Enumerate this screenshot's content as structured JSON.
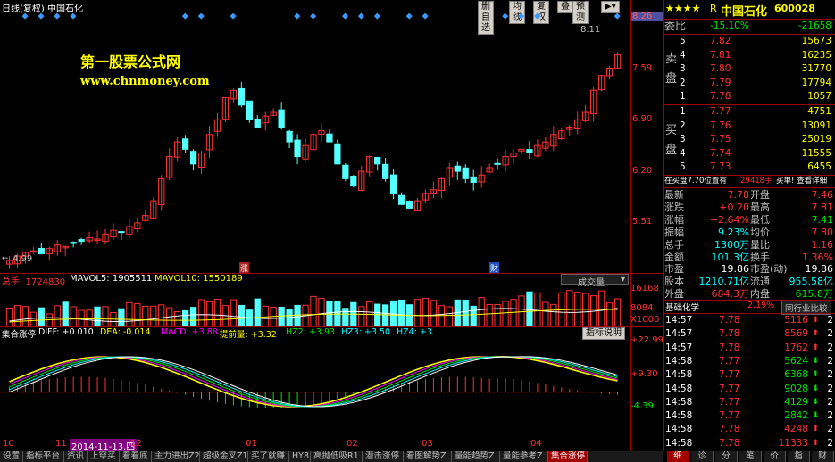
{
  "header": {
    "period": "日线(复权)",
    "stock_name": "中国石化",
    "buttons": [
      "删自选",
      "均线",
      "复权",
      "叠",
      "预测"
    ]
  },
  "watermark": {
    "line1": "第一股票公式网",
    "line2": "www.chnmoney.com"
  },
  "price_axis": {
    "max_label": "8.11",
    "min_label": "4.99",
    "ticks": [
      "8.26",
      "7.59",
      "6.90",
      "6.20",
      "5.51"
    ]
  },
  "event_markers": [
    "涨",
    "财"
  ],
  "volume_panel": {
    "title": "总手: 1724830",
    "mavol5": "MAVOL5: 1905511",
    "mavol10": "MAVOL10: 1550189",
    "dropdown": "成交量",
    "ticks": [
      "16168",
      "8084",
      "X1000"
    ]
  },
  "indicator_panel": {
    "name": "集合涨停",
    "diff": "DIFF: +0.010",
    "dea": "DEA: -0.014",
    "macd": "MACD: +3.88",
    "tiqianliang": "提前量: +3.32",
    "hz2": "HZ2: +3.93",
    "hz3": "HZ3: +3.50",
    "hz4": "HZ4: +3.",
    "button": "指标说明",
    "ticks": [
      "+22.99",
      "+9.30",
      "-4.39"
    ]
  },
  "chart_data": {
    "type": "candlestick",
    "ylim": [
      4.99,
      8.26
    ],
    "x_labels": [
      "10",
      "11",
      "2014-11-13,四",
      "12",
      "01",
      "02",
      "03",
      "04"
    ],
    "close": [
      4.99,
      5.05,
      5.1,
      5.12,
      5.08,
      5.15,
      5.2,
      5.18,
      5.22,
      5.25,
      5.3,
      5.28,
      5.35,
      5.4,
      5.38,
      5.45,
      5.5,
      5.6,
      5.8,
      6.1,
      6.4,
      6.6,
      6.5,
      6.3,
      6.45,
      6.7,
      6.9,
      7.2,
      7.3,
      7.1,
      6.9,
      6.8,
      6.95,
      7.0,
      6.8,
      6.6,
      6.4,
      6.55,
      6.7,
      6.75,
      6.6,
      6.3,
      6.1,
      6.0,
      6.2,
      6.4,
      6.3,
      6.1,
      5.9,
      5.75,
      5.7,
      5.8,
      5.9,
      5.95,
      6.1,
      6.25,
      6.2,
      6.1,
      6.05,
      6.15,
      6.25,
      6.3,
      6.4,
      6.45,
      6.5,
      6.45,
      6.55,
      6.6,
      6.7,
      6.75,
      6.8,
      6.9,
      7.0,
      7.3,
      7.5,
      7.6,
      7.78
    ],
    "volume_max": 16168,
    "macd_ylim": [
      -4.39,
      22.99
    ]
  },
  "quote": {
    "stars": "★★★★",
    "r": "R",
    "name": "中国石化",
    "code": "600028",
    "weibi_label": "委比",
    "weibi": "-15.10%",
    "weicha": "-21658",
    "sell_label": [
      "卖",
      "盘"
    ],
    "buy_label": [
      "买",
      "盘"
    ],
    "sell": [
      {
        "level": "5",
        "price": "7.82",
        "vol": "15673"
      },
      {
        "level": "4",
        "price": "7.81",
        "vol": "16235"
      },
      {
        "level": "3",
        "price": "7.80",
        "vol": "31770"
      },
      {
        "level": "2",
        "price": "7.79",
        "vol": "17794"
      },
      {
        "level": "1",
        "price": "7.78",
        "vol": "1057"
      }
    ],
    "buy": [
      {
        "level": "1",
        "price": "7.77",
        "vol": "4751"
      },
      {
        "level": "2",
        "price": "7.76",
        "vol": "13091"
      },
      {
        "level": "3",
        "price": "7.75",
        "vol": "25019"
      },
      {
        "level": "4",
        "price": "7.74",
        "vol": "11555"
      },
      {
        "level": "5",
        "price": "7.73",
        "vol": "6455"
      }
    ],
    "notice": "在买盘7.70位置有",
    "notice_vol": "29418手",
    "notice_action": "买单! 查看详细",
    "stats": [
      {
        "l1": "最新",
        "v1": "7.78",
        "l2": "开盘",
        "v2": "7.46"
      },
      {
        "l1": "涨跌",
        "v1": "+0.20",
        "l2": "最高",
        "v2": "7.81"
      },
      {
        "l1": "涨幅",
        "v1": "+2.64%",
        "l2": "最低",
        "v2": "7.41"
      },
      {
        "l1": "振幅",
        "v1": "9.23%",
        "l2": "均价",
        "v2": "7.80"
      },
      {
        "l1": "总手",
        "v1": "1300万",
        "l2": "量比",
        "v2": "1.16"
      },
      {
        "l1": "金额",
        "v1": "101.3亿",
        "l2": "换手",
        "v2": "1.36%"
      },
      {
        "l1": "市盈",
        "v1": "19.86",
        "l2": "市盈(动)",
        "v2": "19.86"
      },
      {
        "l1": "股本",
        "v1": "1210.71亿",
        "l2": "流通",
        "v2": "955.58亿"
      },
      {
        "l1": "外盘",
        "v1": "684.3万",
        "l2": "内盘",
        "v2": "615.8万"
      }
    ],
    "sector": "基础化学",
    "sector_change": "2.19%",
    "sector_button": "同行业比较",
    "ticks": [
      {
        "time": "14:57",
        "price": "7.78",
        "vol": "5116",
        "dir": "up",
        "n": "2"
      },
      {
        "time": "14:57",
        "price": "7.78",
        "vol": "8569",
        "dir": "up",
        "n": "2"
      },
      {
        "time": "14:57",
        "price": "7.78",
        "vol": "1762",
        "dir": "up",
        "n": "2"
      },
      {
        "time": "14:58",
        "price": "7.77",
        "vol": "5624",
        "dir": "down",
        "n": "2"
      },
      {
        "time": "14:58",
        "price": "7.77",
        "vol": "6368",
        "dir": "down",
        "n": "2"
      },
      {
        "time": "14:58",
        "price": "7.77",
        "vol": "9028",
        "dir": "down",
        "n": "2"
      },
      {
        "time": "14:58",
        "price": "7.77",
        "vol": "4129",
        "dir": "down",
        "n": "2"
      },
      {
        "time": "14:58",
        "price": "7.77",
        "vol": "2842",
        "dir": "down",
        "n": "2"
      },
      {
        "time": "14:58",
        "price": "7.78",
        "vol": "4248",
        "dir": "up",
        "n": "2"
      },
      {
        "time": "14:58",
        "price": "7.78",
        "vol": "11333",
        "dir": "up",
        "n": "2"
      }
    ],
    "side_tabs": [
      "细",
      "诊",
      "分",
      "笔",
      "价",
      "指",
      "财"
    ]
  },
  "bottom_tabs": [
    "设置",
    "指标平台",
    "资讯",
    "上穿买",
    "看看底",
    "主力进出Z2",
    "超级金叉Z1",
    "买了就赚",
    "HY8",
    "高抛低吸R1",
    "潜击涨停",
    "看图解势Z",
    "量能趋势Z",
    "量能参考Z",
    "集合涨停"
  ]
}
